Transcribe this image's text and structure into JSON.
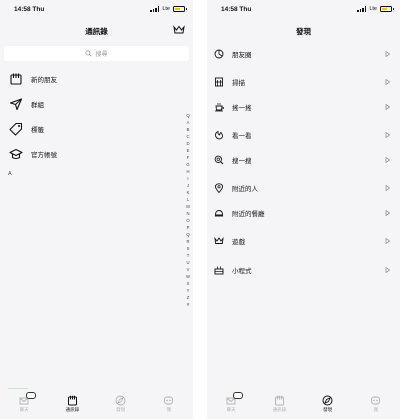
{
  "left": {
    "status": {
      "time": "14:58 Thu",
      "network": "Lte"
    },
    "nav": {
      "title": "通訊錄",
      "crown_icon": "crown-icon"
    },
    "search": {
      "placeholder": "搜尋"
    },
    "items": [
      {
        "label": "新的朋友",
        "icon": "new-friends-icon"
      },
      {
        "label": "群組",
        "icon": "group-paper-plane-icon"
      },
      {
        "label": "標籤",
        "icon": "tag-icon"
      },
      {
        "label": "官方帳號",
        "icon": "graduation-cap-icon"
      }
    ],
    "section_letter": "A",
    "index": [
      "Q",
      "A",
      "B",
      "C",
      "D",
      "E",
      "F",
      "G",
      "H",
      "I",
      "J",
      "K",
      "L",
      "M",
      "N",
      "O",
      "P",
      "Q",
      "R",
      "S",
      "T",
      "U",
      "V",
      "W",
      "X",
      "Y",
      "Z",
      "#"
    ]
  },
  "right": {
    "status": {
      "time": "14:58 Thu",
      "network": "Lte"
    },
    "nav": {
      "title": "發現"
    },
    "items": [
      {
        "label": "朋友圈",
        "icon": "moments-icon"
      },
      {
        "label": "掃描",
        "icon": "scan-icon"
      },
      {
        "label": "搖一搖",
        "icon": "shake-icon"
      },
      {
        "label": "看一看",
        "icon": "look-icon"
      },
      {
        "label": "搜一搜",
        "icon": "search-icon"
      },
      {
        "label": "附近的人",
        "icon": "location-pin-icon"
      },
      {
        "label": "附近的餐廳",
        "icon": "dining-icon"
      },
      {
        "label": "遊戲",
        "icon": "crown-icon"
      },
      {
        "label": "小程式",
        "icon": "mini-program-icon"
      }
    ]
  },
  "tabs_left": [
    {
      "label": "聊天",
      "icon": "chats-icon",
      "active": false
    },
    {
      "label": "通訊錄",
      "icon": "contacts-icon",
      "active": true
    },
    {
      "label": "發現",
      "icon": "discover-icon",
      "active": false
    },
    {
      "label": "我",
      "icon": "me-icon",
      "active": false
    }
  ],
  "tabs_right": [
    {
      "label": "聊天",
      "icon": "chats-icon",
      "active": false
    },
    {
      "label": "通訊錄",
      "icon": "contacts-icon",
      "active": false
    },
    {
      "label": "發現",
      "icon": "discover-icon",
      "active": true
    },
    {
      "label": "我",
      "icon": "me-icon",
      "active": false
    }
  ],
  "colors": {
    "background": "#f5f5f7",
    "battery": "#f2c31e",
    "text": "#111111",
    "muted": "#b0b0b0"
  }
}
